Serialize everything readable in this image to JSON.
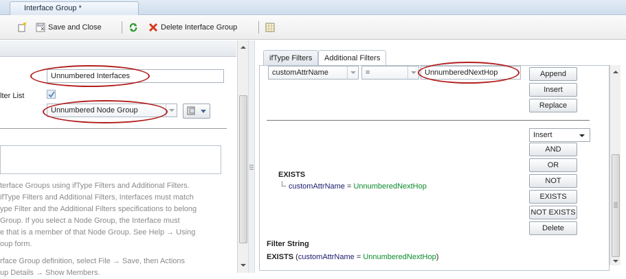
{
  "window": {
    "title": "Interface Group *"
  },
  "toolbar": {
    "save_close": "Save and Close",
    "delete_group": "Delete Interface Group"
  },
  "left": {
    "name_value": "Unnumbered Interfaces",
    "list_label": "lter List",
    "node_group_value": "Unnumbered Node Group",
    "description_lines": [
      "terface Groups using ifType Filters and Additional Filters.",
      " ifType Filters and Additional Filters, Interfaces must match",
      "ype Filter and the Additional Filters specifications to belong",
      " Group. If you select a Node Group, the Interface must",
      "e that is a member of that Node Group. See Help → Using",
      "oup form.",
      "",
      "rface Group definition, select File → Save, then Actions",
      "up Details → Show Members."
    ]
  },
  "tabs": {
    "iftype": "ifType Filters",
    "additional": "Additional Filters"
  },
  "filter": {
    "attr": "customAttrName",
    "op": "=",
    "value": "UnnumberedNextHop"
  },
  "buttons": {
    "append": "Append",
    "insert": "Insert",
    "replace": "Replace",
    "insert_mode": "Insert",
    "and": "AND",
    "or": "OR",
    "not": "NOT",
    "exists": "EXISTS",
    "not_exists": "NOT EXISTS",
    "delete": "Delete"
  },
  "tree": {
    "root": "EXISTS",
    "child_attr": "customAttrName",
    "child_eq": " = ",
    "child_value": "UnnumberedNextHop"
  },
  "filter_string": {
    "label": "Filter String",
    "kw": "EXISTS",
    "open": " (",
    "attr": "customAttrName",
    "eq": " = ",
    "value": "UnnumberedNextHop",
    "close": ")"
  },
  "colors": {
    "highlight_oval": "#b21e1e",
    "value_green": "#0a8a2a",
    "keyword_blue": "#1a1a6e"
  }
}
